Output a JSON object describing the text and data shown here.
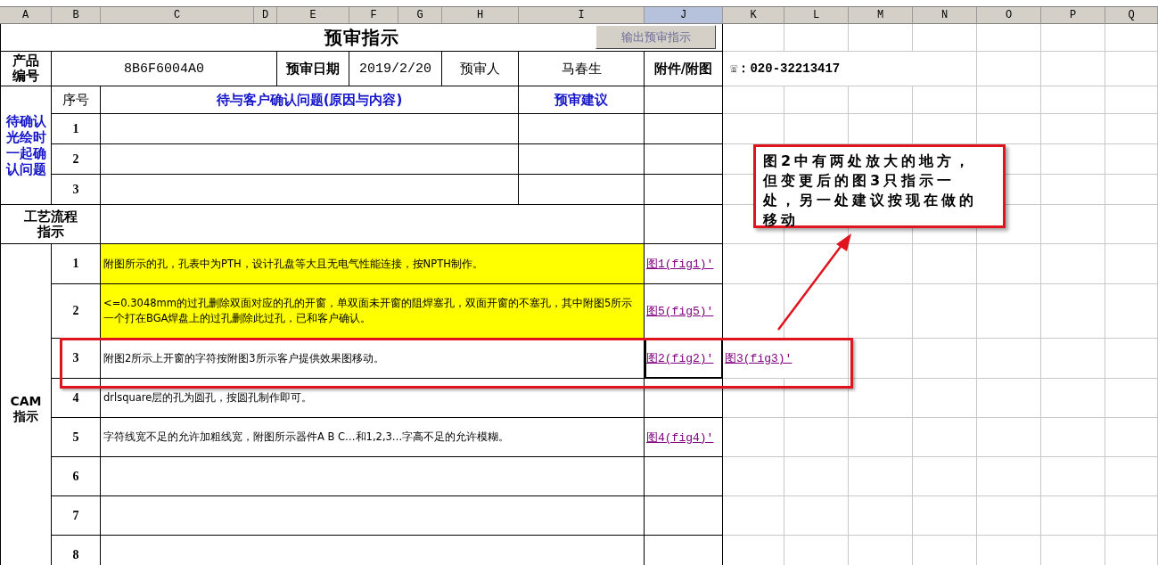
{
  "column_headers": [
    {
      "label": "A",
      "selected": false
    },
    {
      "label": "B",
      "selected": false
    },
    {
      "label": "C",
      "selected": false
    },
    {
      "label": "D",
      "selected": false
    },
    {
      "label": "E",
      "selected": false
    },
    {
      "label": "F",
      "selected": false
    },
    {
      "label": "G",
      "selected": false
    },
    {
      "label": "H",
      "selected": false
    },
    {
      "label": "I",
      "selected": false
    },
    {
      "label": "J",
      "selected": true
    },
    {
      "label": "K",
      "selected": false
    },
    {
      "label": "L",
      "selected": false
    },
    {
      "label": "M",
      "selected": false
    },
    {
      "label": "N",
      "selected": false
    },
    {
      "label": "O",
      "selected": false
    },
    {
      "label": "P",
      "selected": false
    },
    {
      "label": "Q",
      "selected": false
    }
  ],
  "title": "预审指示",
  "export_button": {
    "label": "输出预审指示",
    "disabled": true
  },
  "product": {
    "label": "产品编号",
    "value": "8B6F6004A0",
    "date_label": "预审日期",
    "date": "2019/2/20",
    "reviewer_label": "预审人",
    "reviewer": "马春生",
    "attachment_label": "附件/附图"
  },
  "phone": "☏：020-32213417",
  "pending": {
    "label": "待确认光绘时一起确认问题",
    "no_header": "序号",
    "issue_header": "待与客户确认问题(原因与内容)",
    "advice_header": "预审建议",
    "rows": [
      {
        "no": "1"
      },
      {
        "no": "2"
      },
      {
        "no": "3"
      }
    ]
  },
  "process": {
    "label": "工艺流程指示"
  },
  "cam": {
    "label": "CAM 指示",
    "rows": [
      {
        "no": "1",
        "text": "附图所示的孔，孔表中为PTH，设计孔盘等大且无电气性能连接，按NPTH制作。",
        "highlighted": true,
        "framed": false,
        "selected": false,
        "attachments": [
          "图1(fig1)'"
        ]
      },
      {
        "no": "2",
        "text": "<=0.3048mm的过孔删除双面对应的孔的开窗，单双面未开窗的阻焊塞孔，双面开窗的不塞孔，其中附图5所示一个打在BGA焊盘上的过孔删除此过孔，已和客户确认。",
        "highlighted": true,
        "framed": false,
        "selected": false,
        "attachments": [
          "图5(fig5)'"
        ]
      },
      {
        "no": "3",
        "text": "附图2所示上开窗的字符按附图3所示客户提供效果图移动。",
        "highlighted": false,
        "framed": true,
        "selected": true,
        "attachments": [
          "图2(fig2)'",
          "图3(fig3)'"
        ]
      },
      {
        "no": "4",
        "text": "drlsquare层的孔为圆孔，按圆孔制作即可。",
        "highlighted": false,
        "framed": false,
        "selected": false,
        "attachments": []
      },
      {
        "no": "5",
        "text": "字符线宽不足的允许加粗线宽，附图所示器件A B C…和1,2,3…字高不足的允许模糊。",
        "highlighted": false,
        "framed": false,
        "selected": false,
        "attachments": [
          "图4(fig4)'"
        ]
      },
      {
        "no": "6",
        "highlighted": false,
        "framed": false,
        "selected": false,
        "attachments": []
      },
      {
        "no": "7",
        "highlighted": false,
        "framed": false,
        "selected": false,
        "attachments": []
      },
      {
        "no": "8",
        "highlighted": false,
        "framed": false,
        "selected": false,
        "attachments": []
      }
    ]
  },
  "callout": {
    "text": "图2中有两处放大的地方，但变更后的图3只指示一处，另一处建议按现在做的移动"
  }
}
